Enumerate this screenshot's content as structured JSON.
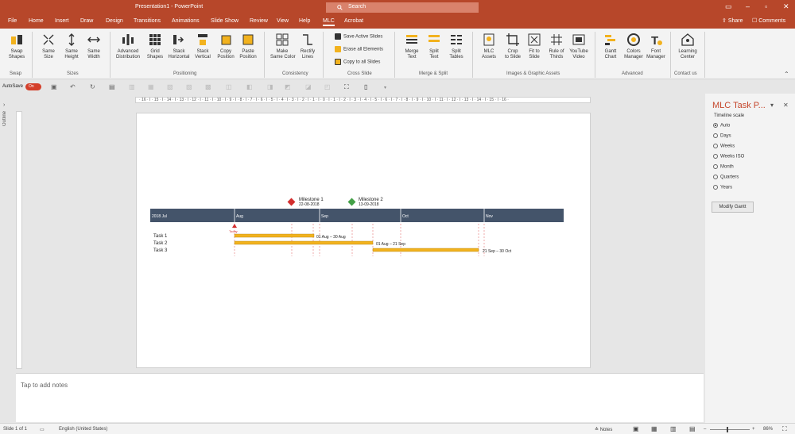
{
  "app": {
    "window_title": "Presentation1 - PowerPoint",
    "search_placeholder": "Search",
    "tabs": [
      "File",
      "Home",
      "Insert",
      "Draw",
      "Design",
      "Transitions",
      "Animations",
      "Slide Show",
      "Review",
      "View",
      "Help",
      "MLC",
      "Acrobat"
    ],
    "active_tab": "MLC",
    "share_label": "Share",
    "comments_label": "Comments"
  },
  "ribbon": {
    "swap": {
      "btn": "Swap\nShapes",
      "group": "Swap"
    },
    "sizes": {
      "btns": [
        "Same\nSize",
        "Same\nHeight",
        "Same\nWidth"
      ],
      "group": "Sizes"
    },
    "positioning": {
      "btns": [
        "Advanced\nDistribution",
        "Grid\nShapes",
        "Stack\nHorizontal",
        "Stack\nVertical",
        "Copy\nPosition",
        "Paste\nPosition"
      ],
      "group": "Positioning"
    },
    "consistency": {
      "btns": [
        "Make\nSame Color",
        "Rectify\nLines"
      ],
      "group": "Consistency"
    },
    "cross_slide": {
      "rows": [
        "Save Active Slides",
        "Erase all Elements",
        "Copy to all Slides"
      ],
      "group": "Cross Slide"
    },
    "merge_split": {
      "btns": [
        "Merge\nText",
        "Split\nText",
        "Split\nTables"
      ],
      "group": "Merge & Split"
    },
    "images": {
      "btns": [
        "MLC\nAssets",
        "Crop\nto Slide",
        "Fit to\nSlide",
        "Rule of\nThirds",
        "YouTube\nVideo"
      ],
      "group": "Images & Graphic Assets"
    },
    "advanced": {
      "btns": [
        "Gantt\nChart",
        "Colors\nManager",
        "Font\nManager"
      ],
      "group": "Advanced"
    },
    "contact": {
      "btns": [
        "Learning\nCenter"
      ],
      "group": "Contact us"
    }
  },
  "qat": {
    "autosave_label": "AutoSave",
    "autosave_state": "On"
  },
  "ruler_text": "· 16 · I · 15 · I · 14 · I · 13 · I · 12 · I · 11 · I · 10 · I · 9 · I · 8 · I · 7 · I · 6 · I · 5 · I · 4 · I · 3 · I · 2 · I · 1 · I · 0 · I · 1 · I · 2 · I · 3 · I · 4 · I · 5 · I · 6 · I · 7 · I · 8 · I · 9 · I · 10 · I · 11 · I · 12 · I · 13 · I · 14 · I · 15 · I · 16 ·",
  "outline_label": "Outline",
  "gantt": {
    "header_color": "#44546a",
    "bar_color": "#f2b21e",
    "months": [
      "2018 Jul",
      "Aug",
      "Sep",
      "Oct",
      "Nov"
    ],
    "milestones": [
      {
        "name": "Milestone 1",
        "date": "22-08-2018",
        "color": "#d32f2f"
      },
      {
        "name": "Milestone 2",
        "date": "13-09-2018",
        "color": "#43a047"
      }
    ],
    "today_label": "Today",
    "tasks": [
      {
        "name": "Task 1",
        "range": "01 Aug – 30 Aug"
      },
      {
        "name": "Task 2",
        "range": "01 Aug – 21 Sep"
      },
      {
        "name": "Task 3",
        "range": "21 Sep – 30 Oct"
      }
    ]
  },
  "taskpane": {
    "title": "MLC Task P...",
    "section": "Timeline scale",
    "options": [
      "Auto",
      "Days",
      "Weeks",
      "Weeks ISO",
      "Month",
      "Quarters",
      "Years"
    ],
    "selected": "Auto",
    "button": "Modify Gantt"
  },
  "notes_placeholder": "Tap to add notes",
  "status": {
    "slide": "Slide 1 of 1",
    "language": "English (United States)",
    "notes": "Notes",
    "zoom": "86%"
  }
}
